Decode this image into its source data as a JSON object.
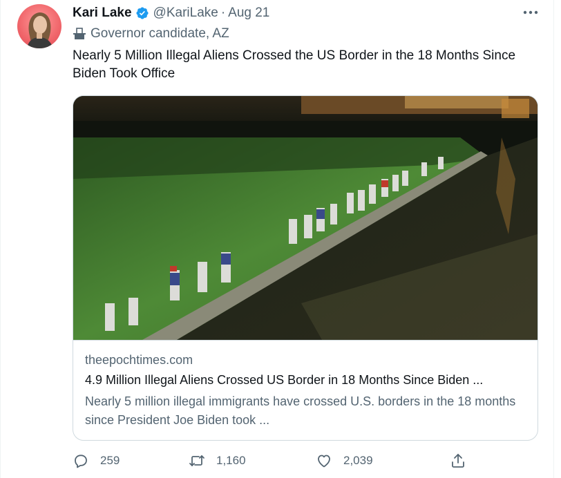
{
  "tweet": {
    "author_name": "Kari Lake",
    "handle": "@KariLake",
    "separator": "·",
    "date": "Aug 21",
    "label": "Governor candidate, AZ",
    "text": "Nearly 5 Million Illegal Aliens Crossed the US Border in the 18 Months Since Biden Took Office"
  },
  "card": {
    "domain": "theepochtimes.com",
    "title": "4.9 Million Illegal Aliens Crossed US Border in 18 Months Since Biden ...",
    "description": "Nearly 5 million illegal immigrants have crossed U.S. borders in the 18 months since President Joe Biden took ..."
  },
  "actions": {
    "reply_count": "259",
    "retweet_count": "1,160",
    "like_count": "2,039"
  },
  "colors": {
    "accent": "#1d9bf0",
    "secondary_text": "#536471",
    "border": "#cfd9de"
  },
  "icons": [
    "verified-badge-icon",
    "more-icon",
    "ballot-box-icon",
    "reply-icon",
    "retweet-icon",
    "like-icon",
    "share-icon"
  ]
}
